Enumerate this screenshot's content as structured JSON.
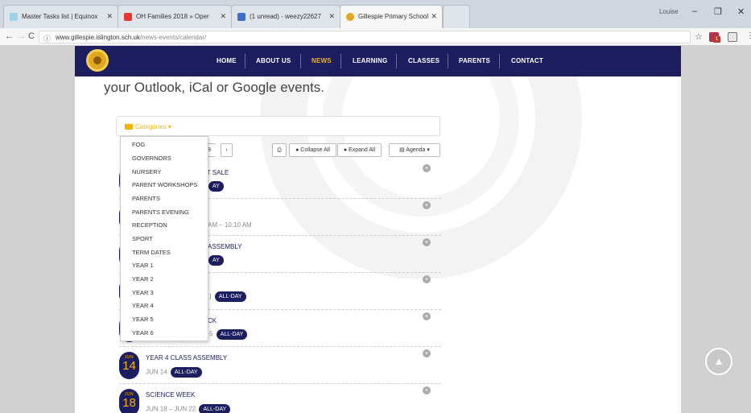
{
  "browser": {
    "tabs": [
      {
        "title": "Master Tasks list | Equinox"
      },
      {
        "title": "OH Families 2018 » Oper"
      },
      {
        "title": "(1 unread) - weezy22627"
      },
      {
        "title": "Gillespie Primary School"
      }
    ],
    "profile_name": "Louise",
    "url_host": "www.gillespie.islington.sch.uk",
    "url_path": "/news-events/calendar/",
    "extension_badge": "1"
  },
  "site": {
    "nav": [
      "HOME",
      "ABOUT US",
      "NEWS",
      "LEARNING",
      "CLASSES",
      "PARENTS",
      "CONTACT"
    ],
    "active_nav": "NEWS",
    "intro_text": "your Outlook, iCal or Google events.",
    "categories_label": "Categories",
    "controls": {
      "year_fragment": "8",
      "next": "›",
      "collapse_all": "Collapse All",
      "expand_all": "Expand All",
      "agenda": "Agenda"
    },
    "category_options": [
      "FOG",
      "GOVERNORS",
      "NURSERY",
      "PARENT WORKSHOPS",
      "PARENTS",
      "PARENTS EVENING",
      "RECEPTION",
      "SPORT",
      "TERM DATES",
      "YEAR 1",
      "YEAR 2",
      "YEAR 3",
      "YEAR 4",
      "YEAR 5",
      "YEAR 6"
    ],
    "events": [
      {
        "month": "",
        "day": "",
        "title": "UT SALE",
        "time": "",
        "allday": "AY"
      },
      {
        "month": "",
        "day": "",
        "title": "",
        "time": "AM – 10:10 AM",
        "allday": ""
      },
      {
        "month": "",
        "day": "",
        "title": "ASSEMBLY",
        "time": "",
        "allday": "AY"
      },
      {
        "month": "",
        "day": "",
        "title": "",
        "time": ")",
        "allday": "ALL-DAY"
      },
      {
        "month": "",
        "day": "",
        "title": "CK",
        "time": "5",
        "allday": "ALL-DAY"
      },
      {
        "month": "JUN",
        "day": "14",
        "title": "YEAR 4 CLASS ASSEMBLY",
        "time": "JUN 14",
        "allday": "ALL-DAY"
      },
      {
        "month": "JUN",
        "day": "18",
        "title": "SCIENCE WEEK",
        "time": "JUN 18 – JUN 22",
        "allday": "ALL-DAY"
      }
    ]
  },
  "colors": {
    "nav_bg": "#1d1e5f",
    "accent": "#f5b400"
  },
  "icons": [
    "folder-icon",
    "print-icon",
    "collapse-icon",
    "expand-icon",
    "agenda-icon",
    "plus-circle-icon",
    "arrow-up-icon"
  ]
}
